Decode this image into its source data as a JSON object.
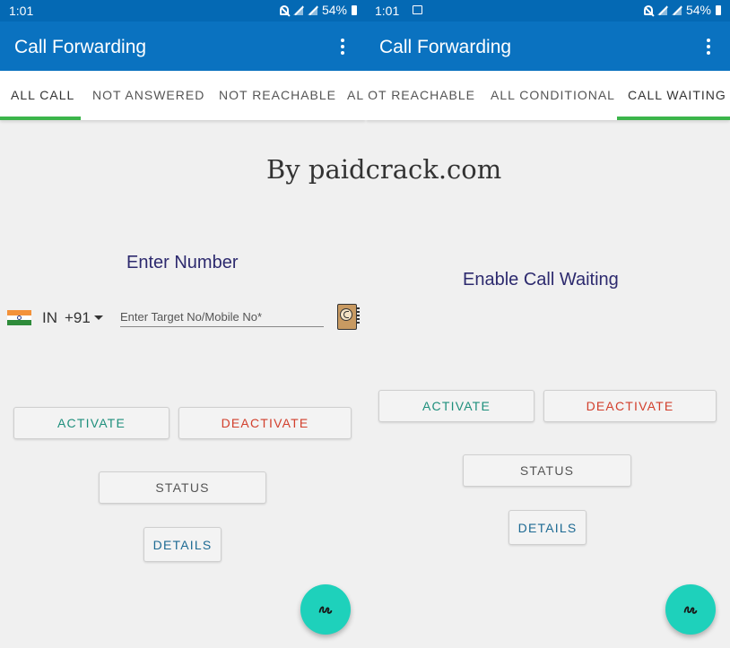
{
  "left_panel": {
    "status_bar": {
      "time": "1:01",
      "battery": "54%"
    },
    "app_bar": {
      "title": "Call Forwarding",
      "menu_icon": "kebab-menu-icon"
    },
    "tabs": [
      {
        "label": "ALL CALL",
        "active": true
      },
      {
        "label": "NOT ANSWERED",
        "active": false
      },
      {
        "label": "NOT REACHABLE",
        "active": false
      },
      {
        "label": "AL",
        "active": false
      }
    ],
    "heading": "Enter Number",
    "country": {
      "code": "IN",
      "dial": "+91",
      "flag_colors": [
        "#f3923a",
        "#ffffff",
        "#2e8b3a"
      ]
    },
    "number_input": {
      "value": "",
      "placeholder": "Enter Target No/Mobile No*"
    },
    "contacts_icon": "contacts-book-icon",
    "buttons": {
      "activate": "ACTIVATE",
      "deactivate": "DEACTIVATE",
      "status": "STATUS",
      "details": "DETAILS"
    },
    "fab_icon": "scribble-icon"
  },
  "right_panel": {
    "status_bar": {
      "time": "1:01",
      "battery": "54%"
    },
    "app_bar": {
      "title": "Call Forwarding",
      "menu_icon": "kebab-menu-icon"
    },
    "tabs": [
      {
        "label": "NOT REACHABLE",
        "active": false
      },
      {
        "label": "ALL CONDITIONAL",
        "active": false
      },
      {
        "label": "CALL WAITING",
        "active": true
      }
    ],
    "heading": "Enable Call Waiting",
    "buttons": {
      "activate": "ACTIVATE",
      "deactivate": "DEACTIVATE",
      "status": "STATUS",
      "details": "DETAILS"
    },
    "fab_icon": "scribble-icon"
  },
  "watermark": "By paidcrack.com",
  "colors": {
    "status_bar": "#0469b4",
    "app_bar": "#0a72c0",
    "tab_indicator": "#3bb54a",
    "heading": "#2d2a6e",
    "activate": "#1e8f7c",
    "deactivate": "#d23f2c",
    "details": "#1d6a93",
    "fab": "#1ed1bb"
  }
}
